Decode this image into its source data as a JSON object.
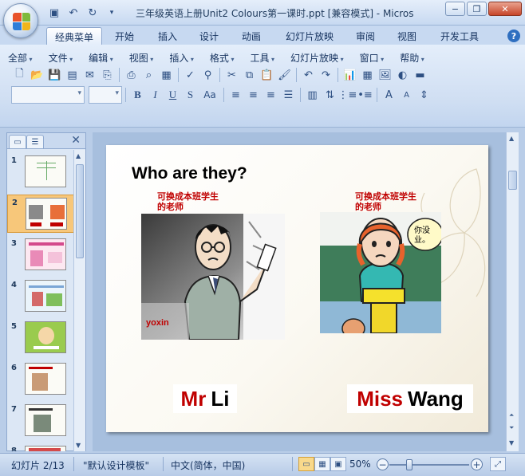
{
  "window": {
    "title": "三年级英语上册Unit2 Colours第一课时.ppt [兼容模式] - Micros",
    "minimize": "−",
    "restore": "❐",
    "close": "✕"
  },
  "qat": {
    "save_icon": "save-icon",
    "undo_icon": "undo-icon",
    "redo_icon": "redo-icon"
  },
  "ribbon_tabs": [
    {
      "label": "经典菜单",
      "active": true
    },
    {
      "label": "开始"
    },
    {
      "label": "插入"
    },
    {
      "label": "设计"
    },
    {
      "label": "动画"
    },
    {
      "label": "幻灯片放映"
    },
    {
      "label": "审阅"
    },
    {
      "label": "视图"
    },
    {
      "label": "开发工具"
    }
  ],
  "help": "?",
  "menu": {
    "items": [
      "全部",
      "文件",
      "编辑",
      "视图",
      "插入",
      "格式",
      "工具",
      "幻灯片放映",
      "窗口",
      "帮助"
    ]
  },
  "font_combo": {
    "value": ""
  },
  "size_combo": {
    "value": ""
  },
  "format_buttons": {
    "bold": "B",
    "italic": "I",
    "underline": "U",
    "strike": "S",
    "case": "Aa"
  },
  "panel": {
    "tab_slides": "▭",
    "tab_outline": "☰",
    "close": "✕",
    "slide_numbers": [
      "1",
      "2",
      "3",
      "4",
      "5",
      "6",
      "7",
      "8"
    ],
    "selected_index": 1
  },
  "slide": {
    "title": "Who are they?",
    "note_left": [
      "可换成本班学生",
      "的老师"
    ],
    "note_right": [
      "可换成本班学生",
      "的老师"
    ],
    "speech_bubble": [
      "你没",
      "业。"
    ],
    "watermark": "yoxin",
    "left_name": {
      "prefix": "Mr",
      "name": "Li"
    },
    "right_name": {
      "prefix": "Miss",
      "name": "Wang"
    }
  },
  "status": {
    "slide_info": "幻灯片 2/13",
    "theme": "\"默认设计模板\"",
    "language": "中文(简体，中国)",
    "zoom": "50%",
    "zoom_value": 0.5
  },
  "colors": {
    "accent_red": "#c00000",
    "ribbon_blue": "#c7d9f1",
    "selected_thumb": "#f7c77a"
  }
}
